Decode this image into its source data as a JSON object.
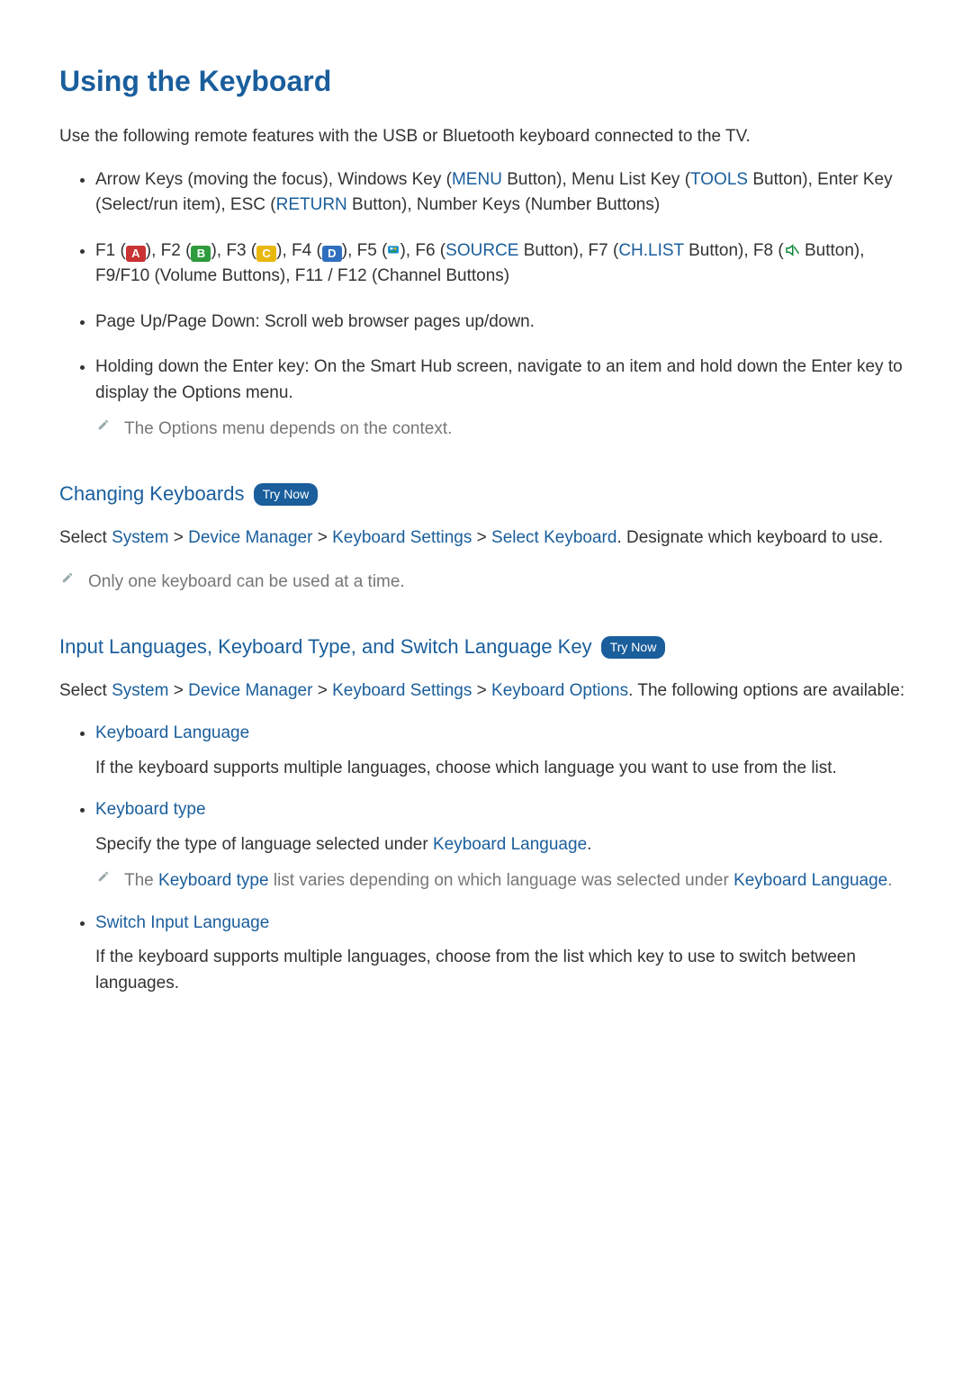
{
  "title": "Using the Keyboard",
  "intro": "Use the following remote features with the USB or Bluetooth keyboard connected to the TV.",
  "bullets": {
    "b1": {
      "p1a": "Arrow Keys (moving the focus), Windows Key (",
      "menu": "MENU",
      "p1b": " Button), Menu List Key (",
      "tools": "TOOLS",
      "p1c": " Button), Enter Key (Select/run item), ESC (",
      "return": "RETURN",
      "p1d": " Button), Number Keys (Number Buttons)"
    },
    "b2": {
      "f1": "F1 (",
      "a": "A",
      "f2": "), F2 (",
      "b": "B",
      "f3": "), F3 (",
      "c": "C",
      "f4": "), F4 (",
      "d": "D",
      "f5": "), F5 (",
      "f6a": "), F6 (",
      "source": "SOURCE",
      "f6b": " Button), F7 (",
      "chlist": "CH.LIST",
      "f7b": " Button), F8 (",
      "f8b": " Button), F9/F10 (Volume Buttons), F11 / F12 (Channel Buttons)"
    },
    "b3": "Page Up/Page Down: Scroll web browser pages up/down.",
    "b4": "Holding down the Enter key: On the Smart Hub screen, navigate to an item and hold down the Enter key to display the Options menu.",
    "b4note": "The Options menu depends on the context."
  },
  "sec1": {
    "title": "Changing Keyboards",
    "try": "Try Now",
    "select": "Select ",
    "system": "System",
    "gt": " > ",
    "dm": "Device Manager",
    "ks": "Keyboard Settings",
    "sk": "Select Keyboard",
    "rest": ". Designate which keyboard to use.",
    "note": "Only one keyboard can be used at a time."
  },
  "sec2": {
    "title": "Input Languages, Keyboard Type, and Switch Language Key",
    "try": "Try Now",
    "select": "Select ",
    "system": "System",
    "gt": " > ",
    "dm": "Device Manager",
    "ks": "Keyboard Settings",
    "ko": "Keyboard Options",
    "rest": ". The following options are available:",
    "opt1": {
      "title": "Keyboard Language",
      "desc": "If the keyboard supports multiple languages, choose which language you want to use from the list."
    },
    "opt2": {
      "title": "Keyboard type",
      "desc_a": "Specify the type of language selected under ",
      "kl": "Keyboard Language",
      "desc_b": ".",
      "note_a": "The ",
      "kt": "Keyboard type",
      "note_b": " list varies depending on which language was selected under ",
      "kl2": "Keyboard Language",
      "note_c": "."
    },
    "opt3": {
      "title": "Switch Input Language",
      "desc": "If the keyboard supports multiple languages, choose from the list which key to use to switch between languages."
    }
  }
}
